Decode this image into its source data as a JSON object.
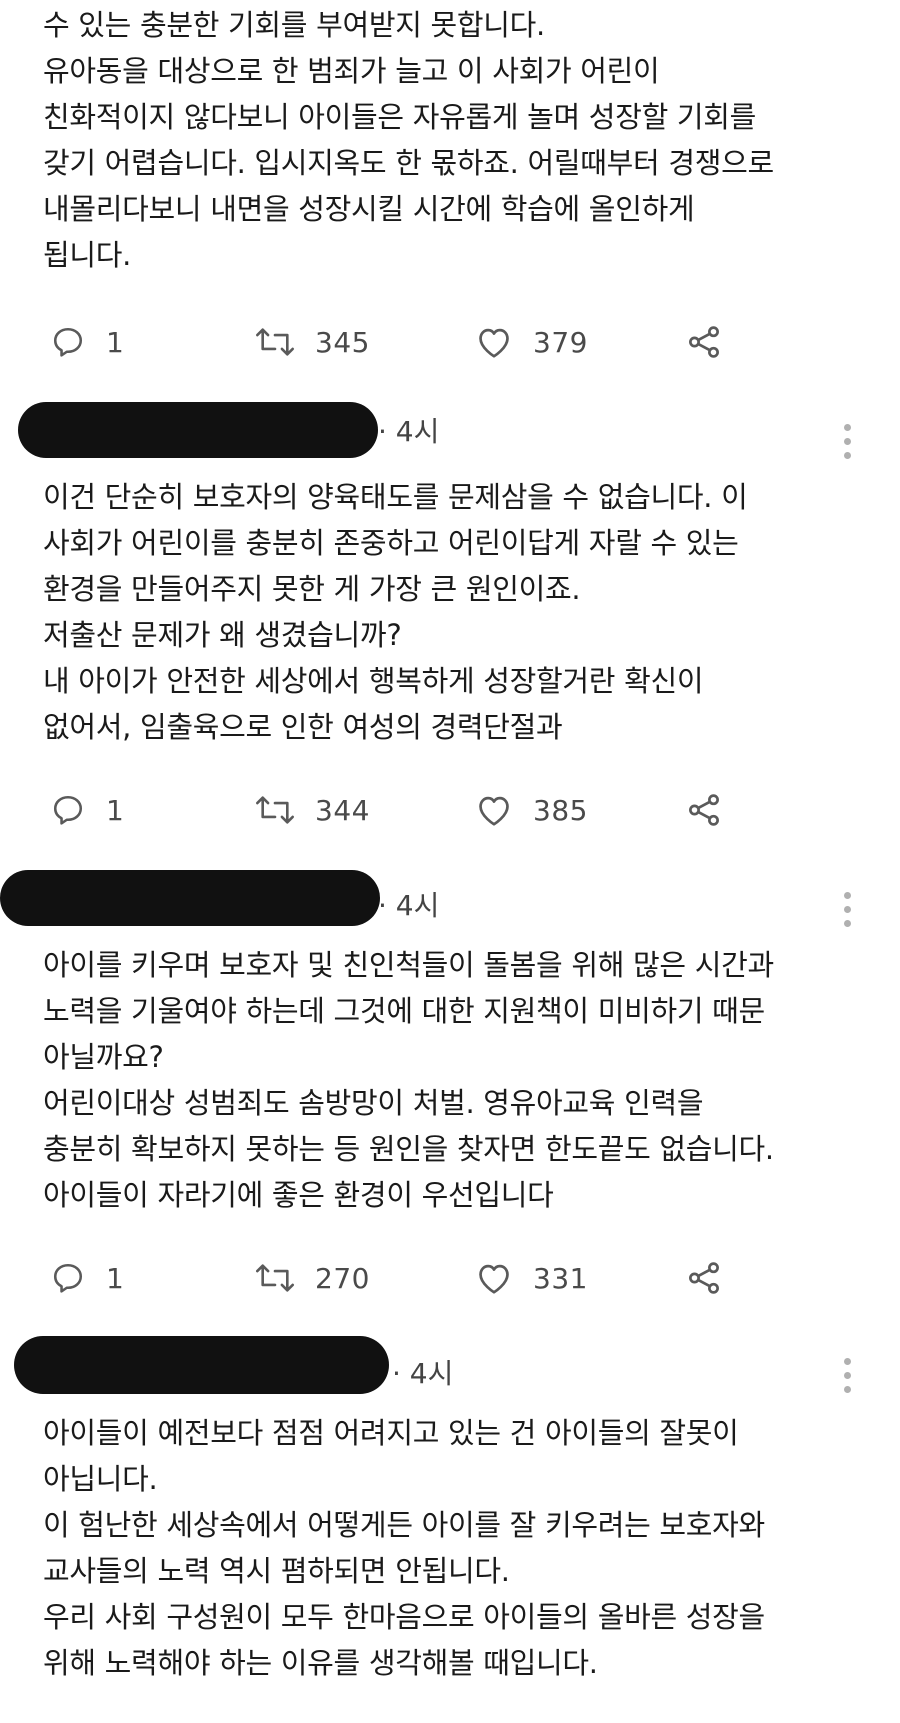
{
  "tweets": [
    {
      "lines": [
        "수 있는 충분한 기회를 부여받지 못합니다.",
        "유아동을 대상으로 한 범죄가 늘고 이 사회가 어린이",
        "친화적이지 않다보니 아이들은 자유롭게 놀며 성장할 기회를",
        "갖기 어렵습니다. 입시지옥도 한 몫하죠. 어릴때부터 경쟁으로",
        "내몰리다보니 내면을 성장시킬 시간에 학습에 올인하게",
        "됩니다."
      ],
      "replies": "1",
      "retweets": "345",
      "likes": "379"
    },
    {
      "time": "· 4시",
      "lines": [
        "이건 단순히 보호자의 양육태도를 문제삼을 수 없습니다. 이",
        "사회가 어린이를 충분히 존중하고 어린이답게 자랄 수 있는",
        "환경을 만들어주지 못한 게 가장 큰 원인이죠.",
        "저출산 문제가 왜 생겼습니까?",
        "내 아이가 안전한 세상에서 행복하게 성장할거란 확신이",
        "없어서, 임출육으로 인한 여성의 경력단절과"
      ],
      "replies": "1",
      "retweets": "344",
      "likes": "385"
    },
    {
      "time": "· 4시",
      "lines": [
        "아이를 키우며 보호자 및 친인척들이 돌봄을 위해 많은 시간과",
        "노력을 기울여야 하는데 그것에 대한 지원책이 미비하기 때문",
        "아닐까요?",
        "어린이대상 성범죄도 솜방망이 처벌. 영유아교육 인력을",
        "충분히 확보하지 못하는 등 원인을 찾자면 한도끝도 없습니다.",
        "아이들이 자라기에 좋은 환경이 우선입니다"
      ],
      "replies": "1",
      "retweets": "270",
      "likes": "331"
    },
    {
      "time": "· 4시",
      "lines": [
        "아이들이 예전보다 점점 어려지고 있는 건 아이들의 잘못이",
        "아닙니다.",
        "이 험난한 세상속에서 어떻게든 아이를 잘 키우려는 보호자와",
        "교사들의 노력 역시 폄하되면 안됩니다.",
        "우리 사회 구성원이 모두 한마음으로 아이들의 올바른 성장을",
        "위해 노력해야 하는 이유를 생각해볼 때입니다."
      ]
    }
  ],
  "icons": {
    "reply": "reply-icon",
    "retweet": "retweet-icon",
    "like": "heart-icon",
    "share": "share-icon",
    "more": "more-icon"
  },
  "colors": {
    "text": "#1a1a1a",
    "icon": "#5a5a5a",
    "redaction": "#111111"
  }
}
